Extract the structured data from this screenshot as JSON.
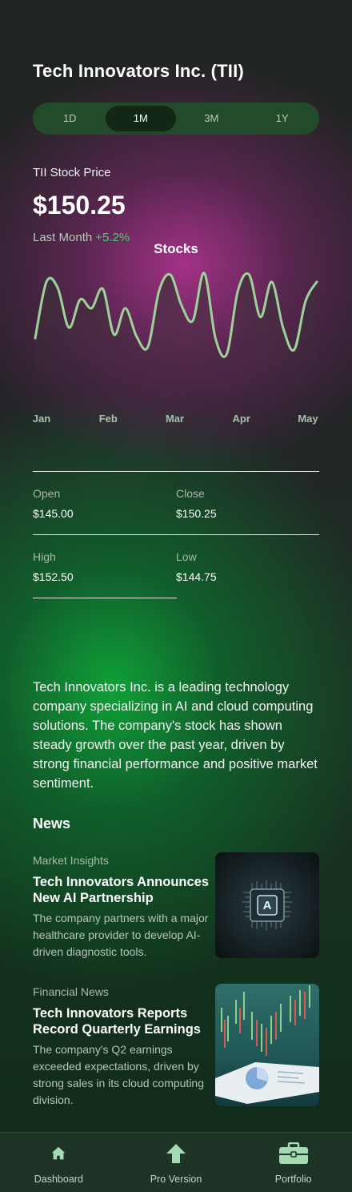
{
  "header": {
    "title": "Tech Innovators Inc. (TII)"
  },
  "ranges": {
    "tabs": [
      {
        "label": "1D",
        "active": false
      },
      {
        "label": "1M",
        "active": true
      },
      {
        "label": "3M",
        "active": false
      },
      {
        "label": "1Y",
        "active": false
      }
    ]
  },
  "price": {
    "label": "TII Stock Price",
    "value": "$150.25",
    "period": "Last Month",
    "change": "+5.2%"
  },
  "chart_data": {
    "type": "line",
    "title": "Stocks",
    "categories": [
      "Jan",
      "Feb",
      "Mar",
      "Apr",
      "May"
    ],
    "xlabel": "",
    "ylabel": "",
    "grid": false,
    "legend": "none",
    "line_color": "#9ed29a",
    "series": [
      {
        "values": [
          0.18,
          0.82,
          0.75,
          0.3,
          0.62,
          0.52,
          0.74,
          0.22,
          0.52,
          0.2,
          0.08,
          0.72,
          0.9,
          0.55,
          0.38,
          0.92,
          0.18,
          0.0,
          0.72,
          0.9,
          0.42,
          0.82,
          0.3,
          0.05,
          0.6,
          0.82
        ]
      }
    ]
  },
  "stats": {
    "open_label": "Open",
    "open_value": "$145.00",
    "close_label": "Close",
    "close_value": "$150.25",
    "high_label": "High",
    "high_value": "$152.50",
    "low_label": "Low",
    "low_value": "$144.75"
  },
  "description": "Tech Innovators Inc. is a leading technology company specializing in AI and cloud computing solutions. The company's stock has shown steady growth over the past year, driven by strong financial performance and positive market sentiment.",
  "news": {
    "heading": "News",
    "items": [
      {
        "category": "Market Insights",
        "title": "Tech Innovators Announces New AI Partnership",
        "body": "The company partners with a major healthcare provider to develop AI-driven diagnostic tools.",
        "chip_letter": "A"
      },
      {
        "category": "Financial News",
        "title": "Tech Innovators Reports Record Quarterly Earnings",
        "body": "The company's Q2 earnings exceeded expectations, driven by strong sales in its cloud computing division."
      }
    ]
  },
  "bottom_nav": {
    "items": [
      {
        "label": "Dashboard",
        "icon": "home-icon"
      },
      {
        "label": "Pro Version",
        "icon": "arrow-up-icon"
      },
      {
        "label": "Portfolio",
        "icon": "briefcase-icon"
      }
    ]
  },
  "colors": {
    "accent": "#3fd26a",
    "nav_bg": "#1d3427",
    "tab_bg": "#244a2c",
    "icon": "#a6dab5"
  }
}
